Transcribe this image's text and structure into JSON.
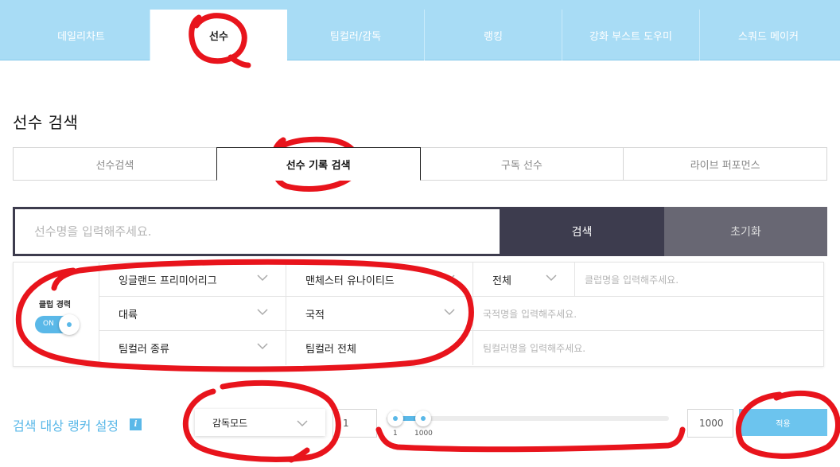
{
  "top_tabs": [
    {
      "label": "데일리차트"
    },
    {
      "label": "선수"
    },
    {
      "label": "팀컬러/감독"
    },
    {
      "label": "랭킹"
    },
    {
      "label": "강화 부스트 도우미"
    },
    {
      "label": "스쿼드 메이커"
    }
  ],
  "section_title": "선수 검색",
  "sub_tabs": [
    {
      "label": "선수검색"
    },
    {
      "label": "선수 기록 검색"
    },
    {
      "label": "구독 선수"
    },
    {
      "label": "라이브 퍼포먼스"
    }
  ],
  "search": {
    "placeholder": "선수명을 입력해주세요.",
    "search_button": "검색",
    "reset_button": "초기화"
  },
  "filters": {
    "club_career_label": "클럽 경력",
    "toggle_label": "ON",
    "league": "잉글랜드 프리미어리그",
    "club": "맨체스터 유나이티드",
    "scope": "전체",
    "club_placeholder": "클럽명을 입력해주세요.",
    "continent": "대륙",
    "nationality": "국적",
    "nationality_placeholder": "국적명을 입력해주세요.",
    "teamcolor_type": "팀컬러 종류",
    "teamcolor_all": "팀컬러 전체",
    "teamcolor_placeholder": "팀컬러명을 입력해주세요."
  },
  "rank_range": {
    "title": "검색 대상 랭커 설정",
    "info_icon": "i",
    "mode": "감독모드",
    "min_value": "1",
    "max_value": "1000",
    "slider_min_label": "1",
    "slider_max_label": "1000",
    "apply_button": "적용"
  },
  "colors": {
    "accent": "#5ab8e8",
    "top_bar": "#a8dcf5",
    "search_dark": "#3d3c4e",
    "reset_gray": "#686773",
    "annotation_red": "#e8141c"
  }
}
